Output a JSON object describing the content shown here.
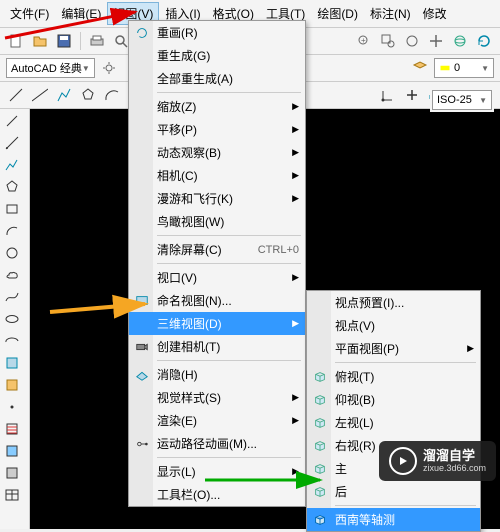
{
  "menubar": {
    "items": [
      {
        "label": "文件(F)"
      },
      {
        "label": "编辑(E)"
      },
      {
        "label": "视图(V)"
      },
      {
        "label": "插入(I)"
      },
      {
        "label": "格式(O)"
      },
      {
        "label": "工具(T)"
      },
      {
        "label": "绘图(D)"
      },
      {
        "label": "标注(N)"
      },
      {
        "label": "修改"
      }
    ],
    "open_index": 2
  },
  "workspace_combo": "AutoCAD 经典",
  "layer_combo": "0",
  "dimstyle_combo": "ISO-25",
  "view_menu": {
    "groups": [
      [
        {
          "label": "重画(R)"
        },
        {
          "label": "重生成(G)"
        },
        {
          "label": "全部重生成(A)"
        }
      ],
      [
        {
          "label": "缩放(Z)",
          "sub": true
        },
        {
          "label": "平移(P)",
          "sub": true
        },
        {
          "label": "动态观察(B)",
          "sub": true
        },
        {
          "label": "相机(C)",
          "sub": true
        },
        {
          "label": "漫游和飞行(K)",
          "sub": true
        },
        {
          "label": "鸟瞰视图(W)"
        }
      ],
      [
        {
          "label": "清除屏幕(C)",
          "shortcut": "CTRL+0"
        }
      ],
      [
        {
          "label": "视口(V)",
          "sub": true
        },
        {
          "label": "命名视图(N)...",
          "icon": "named-view"
        },
        {
          "label": "三维视图(D)",
          "sub": true,
          "hl": true
        },
        {
          "label": "创建相机(T)",
          "icon": "camera"
        }
      ],
      [
        {
          "label": "消隐(H)",
          "icon": "hide"
        },
        {
          "label": "视觉样式(S)",
          "sub": true
        },
        {
          "label": "渲染(E)",
          "sub": true
        },
        {
          "label": "运动路径动画(M)...",
          "icon": "motion"
        }
      ],
      [
        {
          "label": "显示(L)",
          "sub": true
        },
        {
          "label": "工具栏(O)..."
        }
      ]
    ]
  },
  "submenu_3d": {
    "groups": [
      [
        {
          "label": "视点预置(I)..."
        },
        {
          "label": "视点(V)"
        },
        {
          "label": "平面视图(P)",
          "sub": true
        }
      ],
      [
        {
          "label": "俯视(T)",
          "icon": "cube"
        },
        {
          "label": "仰视(B)",
          "icon": "cube"
        },
        {
          "label": "左视(L)",
          "icon": "cube"
        },
        {
          "label": "右视(R)",
          "icon": "cube"
        },
        {
          "label": "主",
          "icon": "cube"
        },
        {
          "label": "后",
          "icon": "cube"
        }
      ],
      [
        {
          "label": "西南等轴测",
          "icon": "cube",
          "hl": true
        }
      ]
    ]
  },
  "watermark": {
    "title": "溜溜自学",
    "url": "zixue.3d66.com"
  }
}
